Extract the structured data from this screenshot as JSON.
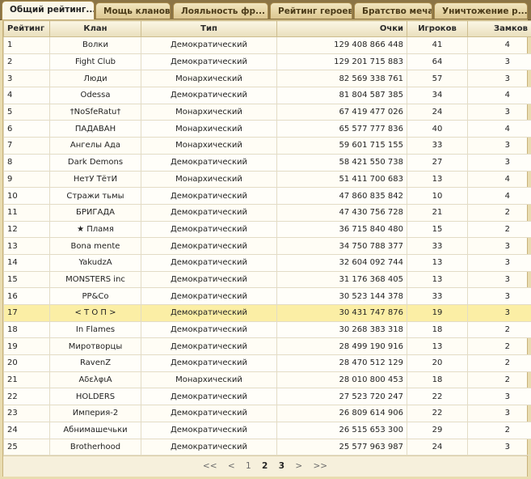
{
  "tabs": [
    {
      "label": "Общий рейтинг..."
    },
    {
      "label": "Мощь кланов"
    },
    {
      "label": "Лояльность фр..."
    },
    {
      "label": "Рейтинг героев"
    },
    {
      "label": "Братство меча"
    },
    {
      "label": "Уничтожение р..."
    }
  ],
  "headers": {
    "rank": "Рейтинг",
    "clan": "Клан",
    "type": "Тип",
    "points": "Очки",
    "players": "Игроков",
    "castles": "Замков"
  },
  "rows": [
    {
      "rank": "1",
      "clan": "Волки",
      "type": "Демократический",
      "points": "129 408 866 448",
      "players": "41",
      "castles": "4"
    },
    {
      "rank": "2",
      "clan": "Fight Club",
      "type": "Демократический",
      "points": "129 201 715 883",
      "players": "64",
      "castles": "3"
    },
    {
      "rank": "3",
      "clan": "Люди",
      "type": "Монархический",
      "points": "82 569 338 761",
      "players": "57",
      "castles": "3"
    },
    {
      "rank": "4",
      "clan": "Odessa",
      "type": "Демократический",
      "points": "81 804 587 385",
      "players": "34",
      "castles": "4"
    },
    {
      "rank": "5",
      "clan": "†NoSfeRatu†",
      "type": "Монархический",
      "points": "67 419 477 026",
      "players": "24",
      "castles": "3"
    },
    {
      "rank": "6",
      "clan": "ПАДАВАН",
      "type": "Монархический",
      "points": "65 577 777 836",
      "players": "40",
      "castles": "4"
    },
    {
      "rank": "7",
      "clan": "Ангелы Ада",
      "type": "Монархический",
      "points": "59 601 715 155",
      "players": "33",
      "castles": "3"
    },
    {
      "rank": "8",
      "clan": "Dark Demons",
      "type": "Демократический",
      "points": "58 421 550 738",
      "players": "27",
      "castles": "3"
    },
    {
      "rank": "9",
      "clan": "НетУ ТётИ",
      "type": "Монархический",
      "points": "51 411 700 683",
      "players": "13",
      "castles": "4"
    },
    {
      "rank": "10",
      "clan": "Стражи тьмы",
      "type": "Демократический",
      "points": "47 860 835 842",
      "players": "10",
      "castles": "4"
    },
    {
      "rank": "11",
      "clan": "БРИГАДА",
      "type": "Демократический",
      "points": "47 430 756 728",
      "players": "21",
      "castles": "2"
    },
    {
      "rank": "12",
      "clan": "★ Пламя",
      "type": "Демократический",
      "points": "36 715 840 480",
      "players": "15",
      "castles": "2"
    },
    {
      "rank": "13",
      "clan": "Bona mente",
      "type": "Демократический",
      "points": "34 750 788 377",
      "players": "33",
      "castles": "3"
    },
    {
      "rank": "14",
      "clan": "YakudzA",
      "type": "Демократический",
      "points": "32 604 092 744",
      "players": "13",
      "castles": "3"
    },
    {
      "rank": "15",
      "clan": "MONSTERS inc",
      "type": "Демократический",
      "points": "31 176 368 405",
      "players": "13",
      "castles": "3"
    },
    {
      "rank": "16",
      "clan": "PP&Co",
      "type": "Демократический",
      "points": "30 523 144 378",
      "players": "33",
      "castles": "3"
    },
    {
      "rank": "17",
      "clan": "< Т О П >",
      "type": "Демократический",
      "points": "30 431 747 876",
      "players": "19",
      "castles": "3"
    },
    {
      "rank": "18",
      "clan": "In Flames",
      "type": "Демократический",
      "points": "30 268 383 318",
      "players": "18",
      "castles": "2"
    },
    {
      "rank": "19",
      "clan": "Миротворцы",
      "type": "Демократический",
      "points": "28 499 190 916",
      "players": "13",
      "castles": "2"
    },
    {
      "rank": "20",
      "clan": "RavenZ",
      "type": "Демократический",
      "points": "28 470 512 129",
      "players": "20",
      "castles": "2"
    },
    {
      "rank": "21",
      "clan": "ΑδελφιΑ",
      "type": "Монархический",
      "points": "28 010 800 453",
      "players": "18",
      "castles": "2"
    },
    {
      "rank": "22",
      "clan": "HOLDERS",
      "type": "Демократический",
      "points": "27 523 720 247",
      "players": "22",
      "castles": "3"
    },
    {
      "rank": "23",
      "clan": "Империя-2",
      "type": "Демократический",
      "points": "26 809 614 906",
      "players": "22",
      "castles": "3"
    },
    {
      "rank": "24",
      "clan": "Абнимашечьки",
      "type": "Демократический",
      "points": "26 515 653 300",
      "players": "29",
      "castles": "2"
    },
    {
      "rank": "25",
      "clan": "Brotherhood",
      "type": "Демократический",
      "points": "25 577 963 987",
      "players": "24",
      "castles": "3"
    }
  ],
  "pager": {
    "first": "<<",
    "prev": "<",
    "pages": [
      "1",
      "2",
      "3"
    ],
    "next": ">",
    "last": ">>"
  }
}
